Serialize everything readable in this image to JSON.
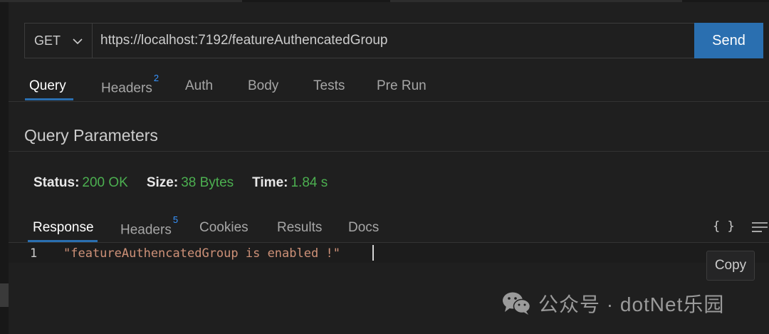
{
  "request": {
    "method": "GET",
    "url": "https://localhost:7192/featureAuthencatedGroup",
    "send_label": "Send"
  },
  "request_tabs": [
    {
      "label": "Query",
      "active": true
    },
    {
      "label": "Headers",
      "badge": "2"
    },
    {
      "label": "Auth"
    },
    {
      "label": "Body"
    },
    {
      "label": "Tests"
    },
    {
      "label": "Pre Run"
    }
  ],
  "query_section_title": "Query Parameters",
  "status": {
    "status_label": "Status:",
    "status_value": "200 OK",
    "size_label": "Size:",
    "size_value": "38 Bytes",
    "time_label": "Time:",
    "time_value": "1.84 s"
  },
  "response_tabs": [
    {
      "label": "Response",
      "active": true
    },
    {
      "label": "Headers",
      "badge": "5"
    },
    {
      "label": "Cookies"
    },
    {
      "label": "Results"
    },
    {
      "label": "Docs"
    }
  ],
  "toolbar": {
    "braces_icon": "{ }",
    "wrap_icon": "word-wrap-icon"
  },
  "response_body": {
    "line_number": "1",
    "line_text": "\"featureAuthencatedGroup is enabled !\""
  },
  "copy_label": "Copy",
  "watermark": {
    "text": "公众号 · dotNet乐园",
    "icon": "wechat-icon"
  },
  "colors": {
    "accent": "#2a6fb0",
    "success": "#4caf50",
    "string": "#ce9178",
    "badge": "#3794ff"
  }
}
